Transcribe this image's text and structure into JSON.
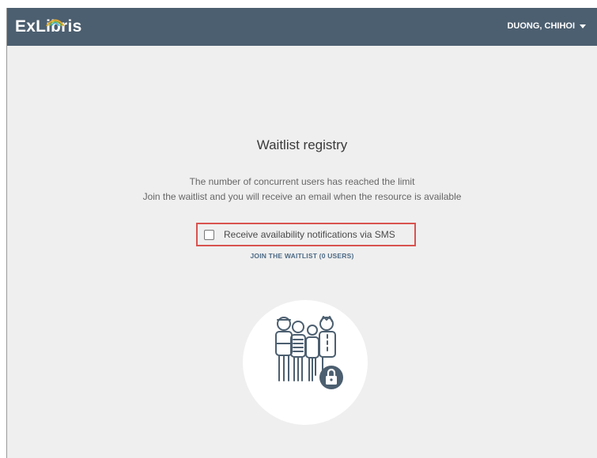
{
  "header": {
    "logo_text": "ExLibris",
    "user_name": "DUONG, CHIHOI"
  },
  "main": {
    "title": "Waitlist registry",
    "message_line1": "The number of concurrent users has reached the limit",
    "message_line2": "Join the waitlist and you will receive an email when the resource is available",
    "sms_label": "Receive availability notifications via SMS",
    "sms_checked": false,
    "join_label": "JOIN THE WAITLIST (0 USERS)"
  },
  "colors": {
    "header_bg": "#4c5f70",
    "page_bg": "#efefef",
    "highlight_border": "#d9534f",
    "link": "#4c6a85"
  },
  "icons": {
    "illustration": "waiting-people-lock-illustration"
  }
}
